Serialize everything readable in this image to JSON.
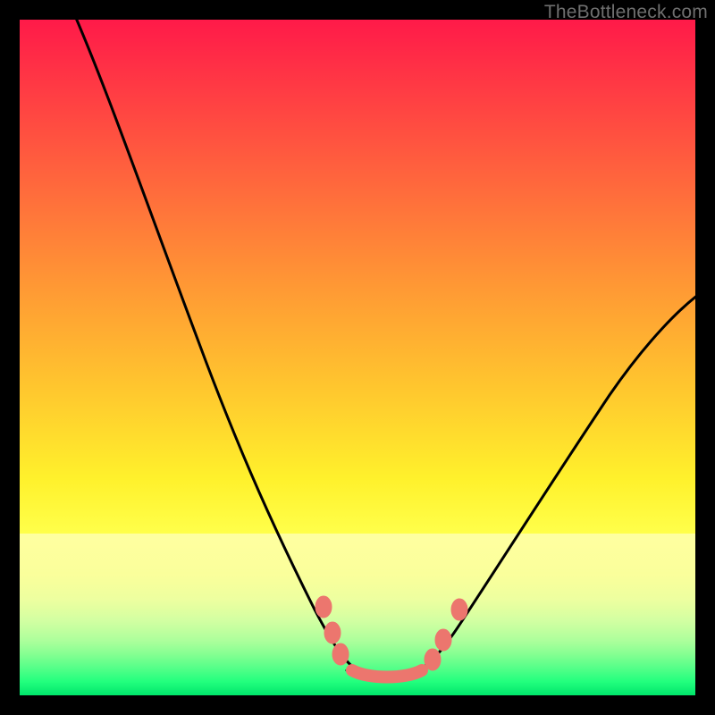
{
  "watermark": "TheBottleneck.com",
  "colors": {
    "frame": "#000000",
    "gradient_top": "#ff1a49",
    "gradient_mid": "#ffd32c",
    "gradient_bottom": "#00e56b",
    "curve": "#000000",
    "marker": "#ec766e"
  },
  "chart_data": {
    "type": "line",
    "title": "",
    "xlabel": "",
    "ylabel": "",
    "xlim": [
      0,
      100
    ],
    "ylim": [
      0,
      100
    ],
    "grid": false,
    "legend": false,
    "note": "Axis values are inferred percentage coordinates on a 0–100 scale; y=0 is the bottom (green) and y=100 is the top (red). Two smooth curves descend from the left and right respectively, meeting in a flat trough near the bottom center where marker points are clustered.",
    "series": [
      {
        "name": "left-descending-curve",
        "x": [
          8,
          14,
          20,
          26,
          32,
          38,
          42,
          46,
          48,
          50,
          52
        ],
        "y": [
          102,
          86,
          68,
          52,
          38,
          26,
          18,
          10,
          6,
          4,
          3
        ]
      },
      {
        "name": "right-descending-curve",
        "x": [
          100,
          94,
          88,
          82,
          76,
          70,
          66,
          62,
          60,
          58
        ],
        "y": [
          54,
          46,
          38,
          30,
          22,
          14,
          10,
          6,
          4,
          3
        ]
      },
      {
        "name": "trough-flat",
        "x": [
          48,
          50,
          52,
          54,
          56,
          58,
          60
        ],
        "y": [
          4,
          3.2,
          3,
          3,
          3,
          3.2,
          4
        ]
      }
    ],
    "markers": [
      {
        "x": 45,
        "y": 13
      },
      {
        "x": 46.5,
        "y": 9
      },
      {
        "x": 48,
        "y": 6
      },
      {
        "x": 50,
        "y": 3.5
      },
      {
        "x": 52,
        "y": 3
      },
      {
        "x": 54,
        "y": 3
      },
      {
        "x": 56,
        "y": 3
      },
      {
        "x": 58,
        "y": 3.2
      },
      {
        "x": 60,
        "y": 4
      },
      {
        "x": 62,
        "y": 6.5
      },
      {
        "x": 64.5,
        "y": 10
      },
      {
        "x": 66,
        "y": 13
      }
    ]
  }
}
